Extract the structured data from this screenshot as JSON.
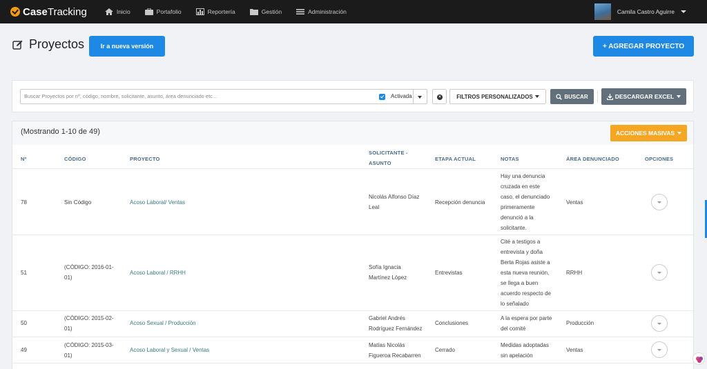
{
  "nav": {
    "brand_bold": "Case",
    "brand_light": "Tracking",
    "items": [
      {
        "label": "Inicio",
        "icon": "home-icon"
      },
      {
        "label": "Portafolio",
        "icon": "briefcase-icon"
      },
      {
        "label": "Reportería",
        "icon": "bar-chart-icon"
      },
      {
        "label": "Gestión",
        "icon": "folder-icon"
      },
      {
        "label": "Administración",
        "icon": "menu-icon"
      }
    ],
    "user_name": "Camila Castro Aguirre"
  },
  "header": {
    "title": "Proyectos",
    "version_button": "Ir a nueva versión",
    "add_button": "+ AGREGAR PROYECTO"
  },
  "search": {
    "placeholder": "Buscar Proyectos por nº, código, nombre, solicitante, asunto, área denunciado etc...",
    "activada_label": "Activada",
    "filters_label": "FILTROS PERSONALIZADOS",
    "buscar_label": "BUSCAR",
    "excel_label": "DESCARGAR EXCEL"
  },
  "table": {
    "showing": "(Mostrando 1-10 de 49)",
    "bulk_actions": "ACCIONES MASIVAS",
    "headers": {
      "n": "Nº",
      "codigo": "CÓDIGO",
      "proyecto": "PROYECTO",
      "solicitante_1": "SOLICITANTE -",
      "solicitante_2": "ASUNTO",
      "etapa": "ETAPA ACTUAL",
      "notas": "NOTAS",
      "area": "ÁREA DENUNCIADO",
      "opciones": "OPCIONES"
    },
    "rows": [
      {
        "n": "78",
        "codigo": [
          "Sin Código"
        ],
        "proyecto": "Acoso Laboral/ Ventas",
        "solicitante": [
          "Nicolás Alfonso Díaz",
          "Leal"
        ],
        "etapa": "Recepción denuncia",
        "notas": [
          "Hay una denuncia",
          "cruzada en este",
          "caso, el denunciado",
          "primeramente",
          "denunció a la",
          "solicitante."
        ],
        "area": "Ventas"
      },
      {
        "n": "51",
        "codigo": [
          "(CÓDIGO: 2016-01-",
          "01)"
        ],
        "proyecto": "Acoso Laboral / RRHH",
        "solicitante": [
          "Sofía Ignacia",
          "Martínez López"
        ],
        "etapa": "Entrevistas",
        "notas": [
          "Cité a testigos a",
          "entrevista y doña",
          "Berta Rojas asiste a",
          "esta nueva reunión,",
          "se llega a buen",
          "acuerdo respecto de",
          "lo señalado"
        ],
        "area": "RRHH"
      },
      {
        "n": "50",
        "codigo": [
          "(CÓDIGO: 2015-02-",
          "01)"
        ],
        "proyecto": "Acoso Sexual / Producción",
        "solicitante": [
          "Gabriel Andrés",
          "Rodríguez Fernández"
        ],
        "etapa": "Conclusiones",
        "notas": [
          "A la espera por parte",
          "del comité"
        ],
        "area": "Producción"
      },
      {
        "n": "49",
        "codigo": [
          "(CÓDIGO: 2015-03-",
          "01)"
        ],
        "proyecto": "Acoso Laboral y Sexual / Ventas",
        "solicitante": [
          "Matías Nicolás",
          "Figueroa Recabarren"
        ],
        "etapa": "Cerrado",
        "notas": [
          "Medidas adoptadas",
          "sin apelación"
        ],
        "area": "Ventas"
      }
    ]
  },
  "colors": {
    "primary": "#1e88e5",
    "navbar": "#1b1b1b",
    "warning": "#f5a623",
    "secondary": "#62707c",
    "link": "#3a7a84"
  }
}
